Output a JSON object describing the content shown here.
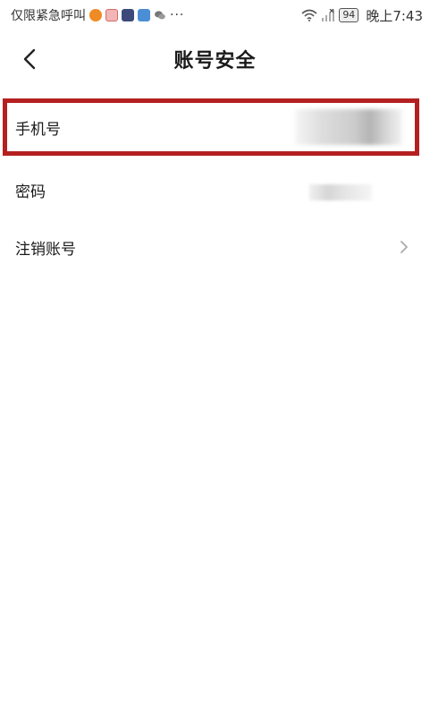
{
  "status_bar": {
    "carrier_text": "仅限紧急呼叫",
    "more": "···",
    "battery": "94",
    "time": "晚上7:43",
    "icons": [
      "app-orange-icon",
      "app-pink-icon",
      "app-navy-icon",
      "app-blue-icon",
      "wechat-icon",
      "wifi-icon",
      "signal-icon",
      "battery-icon"
    ]
  },
  "header": {
    "title": "账号安全",
    "back_icon": "chevron-left-icon"
  },
  "list": {
    "items": [
      {
        "label": "手机号",
        "value_redacted": true
      },
      {
        "label": "密码",
        "value_redacted": true
      },
      {
        "label": "注销账号",
        "icon": "chevron-right-icon"
      }
    ]
  },
  "highlight": {
    "color": "#b42020",
    "target": "手机号"
  }
}
